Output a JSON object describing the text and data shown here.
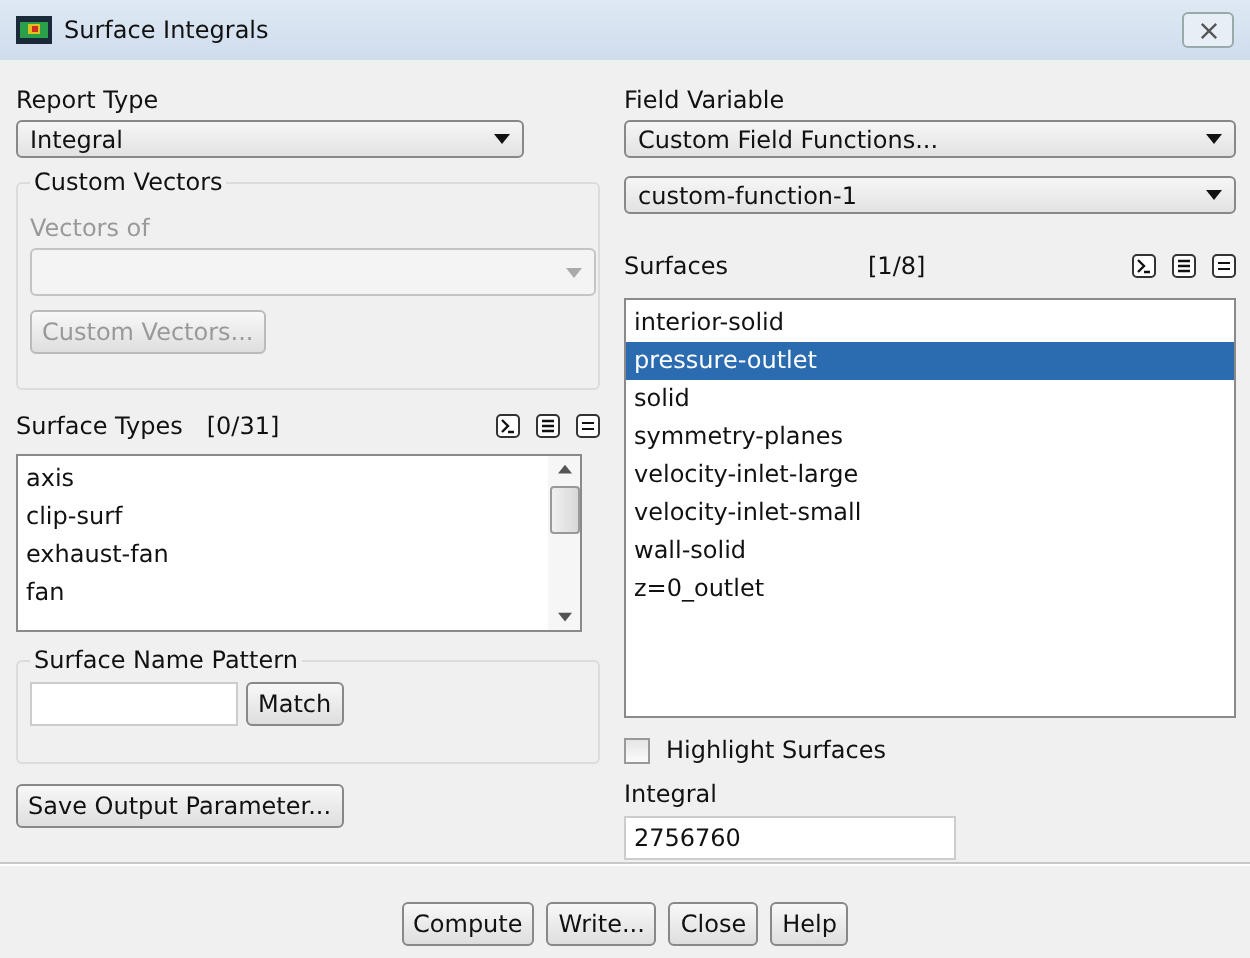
{
  "window": {
    "title": "Surface Integrals"
  },
  "report_type": {
    "label": "Report Type",
    "value": "Integral"
  },
  "custom_vectors": {
    "title": "Custom Vectors",
    "label": "Vectors of",
    "disabled": true,
    "button": "Custom Vectors..."
  },
  "surface_types": {
    "label": "Surface Types",
    "count": "[0/31]",
    "items": [
      {
        "name": "axis",
        "selected": false
      },
      {
        "name": "clip-surf",
        "selected": false
      },
      {
        "name": "exhaust-fan",
        "selected": false
      },
      {
        "name": "fan",
        "selected": false
      }
    ]
  },
  "surface_name_pattern": {
    "title": "Surface Name Pattern",
    "button": "Match"
  },
  "save_button": "Save Output Parameter...",
  "field_variable": {
    "label": "Field Variable",
    "value": "Custom Field Functions...",
    "sub_value": "custom-function-1"
  },
  "surfaces": {
    "label": "Surfaces",
    "count": "[1/8]",
    "items": [
      {
        "name": "interior-solid",
        "selected": false
      },
      {
        "name": "pressure-outlet",
        "selected": true
      },
      {
        "name": "solid",
        "selected": false
      },
      {
        "name": "symmetry-planes",
        "selected": false
      },
      {
        "name": "velocity-inlet-large",
        "selected": false
      },
      {
        "name": "velocity-inlet-small",
        "selected": false
      },
      {
        "name": "wall-solid",
        "selected": false
      },
      {
        "name": "z=0_outlet",
        "selected": false
      }
    ]
  },
  "highlight_surfaces": {
    "label": "Highlight Surfaces",
    "checked": false
  },
  "integral": {
    "label": "Integral",
    "value": "2756760"
  },
  "buttons": [
    "Compute",
    "Write...",
    "Close",
    "Help"
  ]
}
